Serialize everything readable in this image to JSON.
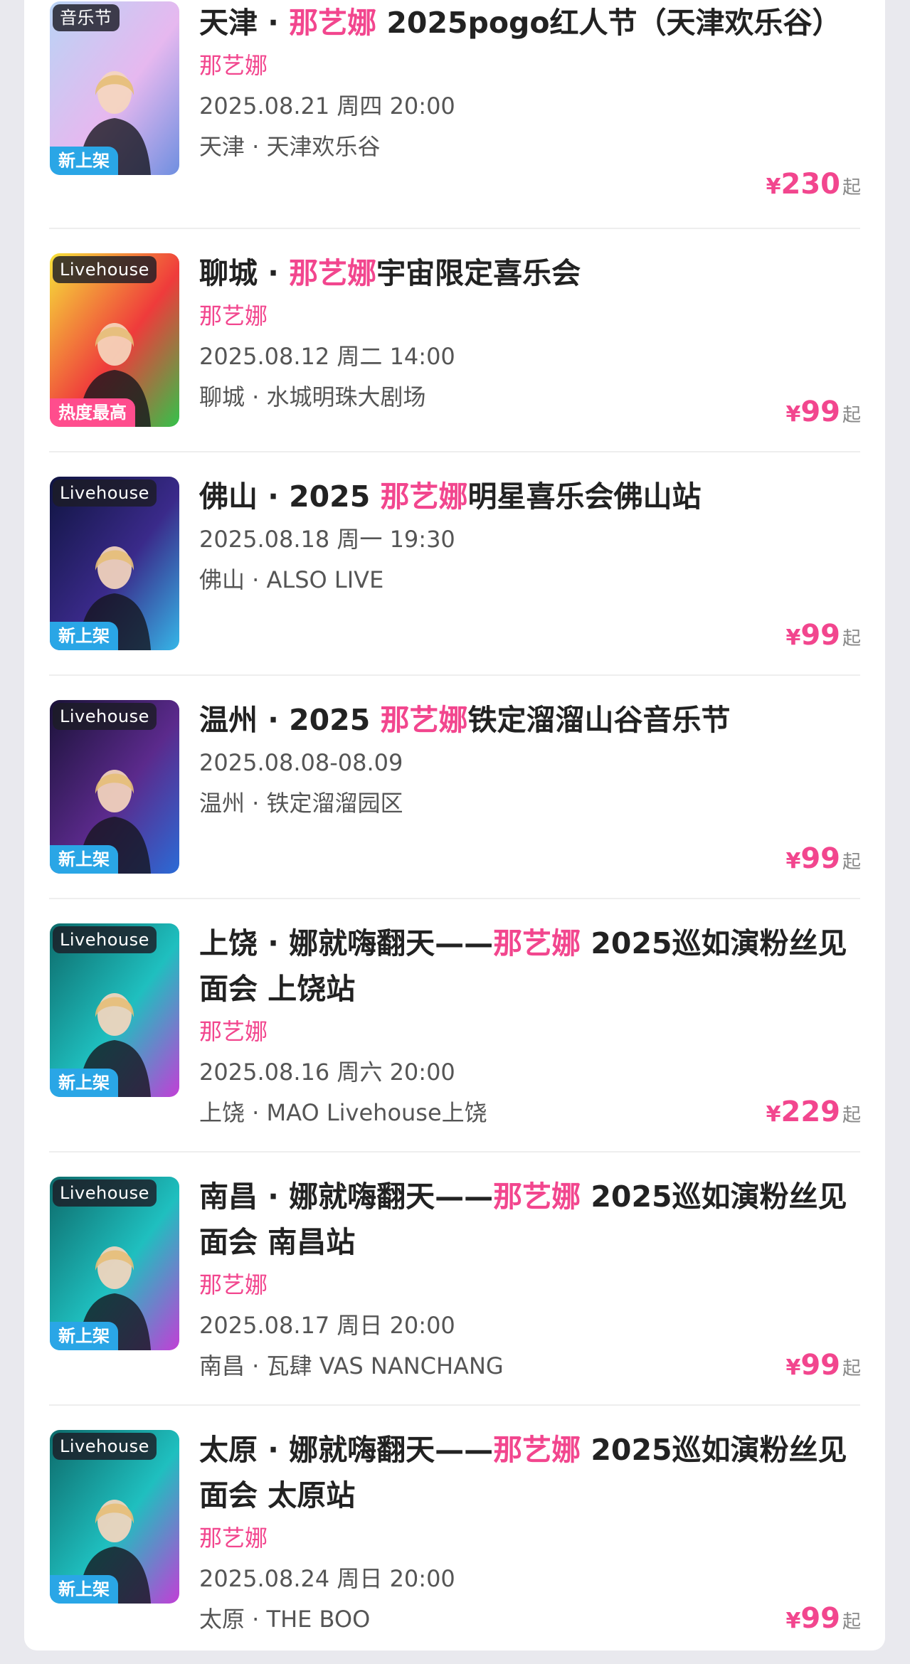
{
  "listings": [
    {
      "tag_top": "音乐节",
      "tag_bottom": "新上架",
      "tag_bottom_kind": "new",
      "title_prefix": "天津 · ",
      "title_highlight": "那艺娜",
      "title_suffix": " 2025pogo红人节（天津欢乐谷）",
      "artist": "那艺娜",
      "date": "2025.08.21 周四 20:00",
      "venue": "天津 · 天津欢乐谷",
      "price_currency": "¥",
      "price_value": "230",
      "price_suffix": "起",
      "poster_colors": [
        "#b9d4f5",
        "#e6b8ef",
        "#6f8fe0"
      ]
    },
    {
      "tag_top": "Livehouse",
      "tag_bottom": "热度最高",
      "tag_bottom_kind": "hot",
      "title_prefix": "聊城 · ",
      "title_highlight": "那艺娜",
      "title_suffix": "宇宙限定喜乐会",
      "artist": "那艺娜",
      "date": "2025.08.12 周二 14:00",
      "venue": "聊城 · 水城明珠大剧场",
      "price_currency": "¥",
      "price_value": "99",
      "price_suffix": "起",
      "poster_colors": [
        "#f6e23a",
        "#ef3b3b",
        "#33c24a"
      ]
    },
    {
      "tag_top": "Livehouse",
      "tag_bottom": "新上架",
      "tag_bottom_kind": "new",
      "title_prefix": "佛山 · 2025 ",
      "title_highlight": "那艺娜",
      "title_suffix": "明星喜乐会佛山站",
      "artist": "",
      "date": "2025.08.18 周一 19:30",
      "venue": "佛山 · ALSO LIVE",
      "price_currency": "¥",
      "price_value": "99",
      "price_suffix": "起",
      "poster_colors": [
        "#0f1440",
        "#3a2a8a",
        "#36b6e8"
      ]
    },
    {
      "tag_top": "Livehouse",
      "tag_bottom": "新上架",
      "tag_bottom_kind": "new",
      "title_prefix": "温州 · 2025 ",
      "title_highlight": "那艺娜",
      "title_suffix": "铁定溜溜山谷音乐节",
      "artist": "",
      "date": "2025.08.08-08.09",
      "venue": "温州 · 铁定溜溜园区",
      "price_currency": "¥",
      "price_value": "99",
      "price_suffix": "起",
      "poster_colors": [
        "#1a1238",
        "#5b2a8c",
        "#2b6bd6"
      ]
    },
    {
      "tag_top": "Livehouse",
      "tag_bottom": "新上架",
      "tag_bottom_kind": "new",
      "title_prefix": "上饶 · 娜就嗨翻天——",
      "title_highlight": "那艺娜",
      "title_suffix": " 2025巡如演粉丝见面会 上饶站",
      "artist": "那艺娜",
      "date": "2025.08.16 周六 20:00",
      "venue": "上饶 · MAO Livehouse上饶",
      "price_currency": "¥",
      "price_value": "229",
      "price_suffix": "起",
      "poster_colors": [
        "#0d6a6a",
        "#1fbfbf",
        "#c13fd6"
      ]
    },
    {
      "tag_top": "Livehouse",
      "tag_bottom": "新上架",
      "tag_bottom_kind": "new",
      "title_prefix": "南昌 · 娜就嗨翻天——",
      "title_highlight": "那艺娜",
      "title_suffix": " 2025巡如演粉丝见面会 南昌站",
      "artist": "那艺娜",
      "date": "2025.08.17 周日 20:00",
      "venue": "南昌 · 瓦肆 VAS NANCHANG",
      "price_currency": "¥",
      "price_value": "99",
      "price_suffix": "起",
      "poster_colors": [
        "#0d6a6a",
        "#1fbfbf",
        "#c13fd6"
      ]
    },
    {
      "tag_top": "Livehouse",
      "tag_bottom": "新上架",
      "tag_bottom_kind": "new",
      "title_prefix": "太原 · 娜就嗨翻天——",
      "title_highlight": "那艺娜",
      "title_suffix": " 2025巡如演粉丝见面会 太原站",
      "artist": "那艺娜",
      "date": "2025.08.24 周日 20:00",
      "venue": "太原 · THE BOO",
      "price_currency": "¥",
      "price_value": "99",
      "price_suffix": "起",
      "poster_colors": [
        "#0d6a6a",
        "#1fbfbf",
        "#c13fd6"
      ]
    }
  ]
}
